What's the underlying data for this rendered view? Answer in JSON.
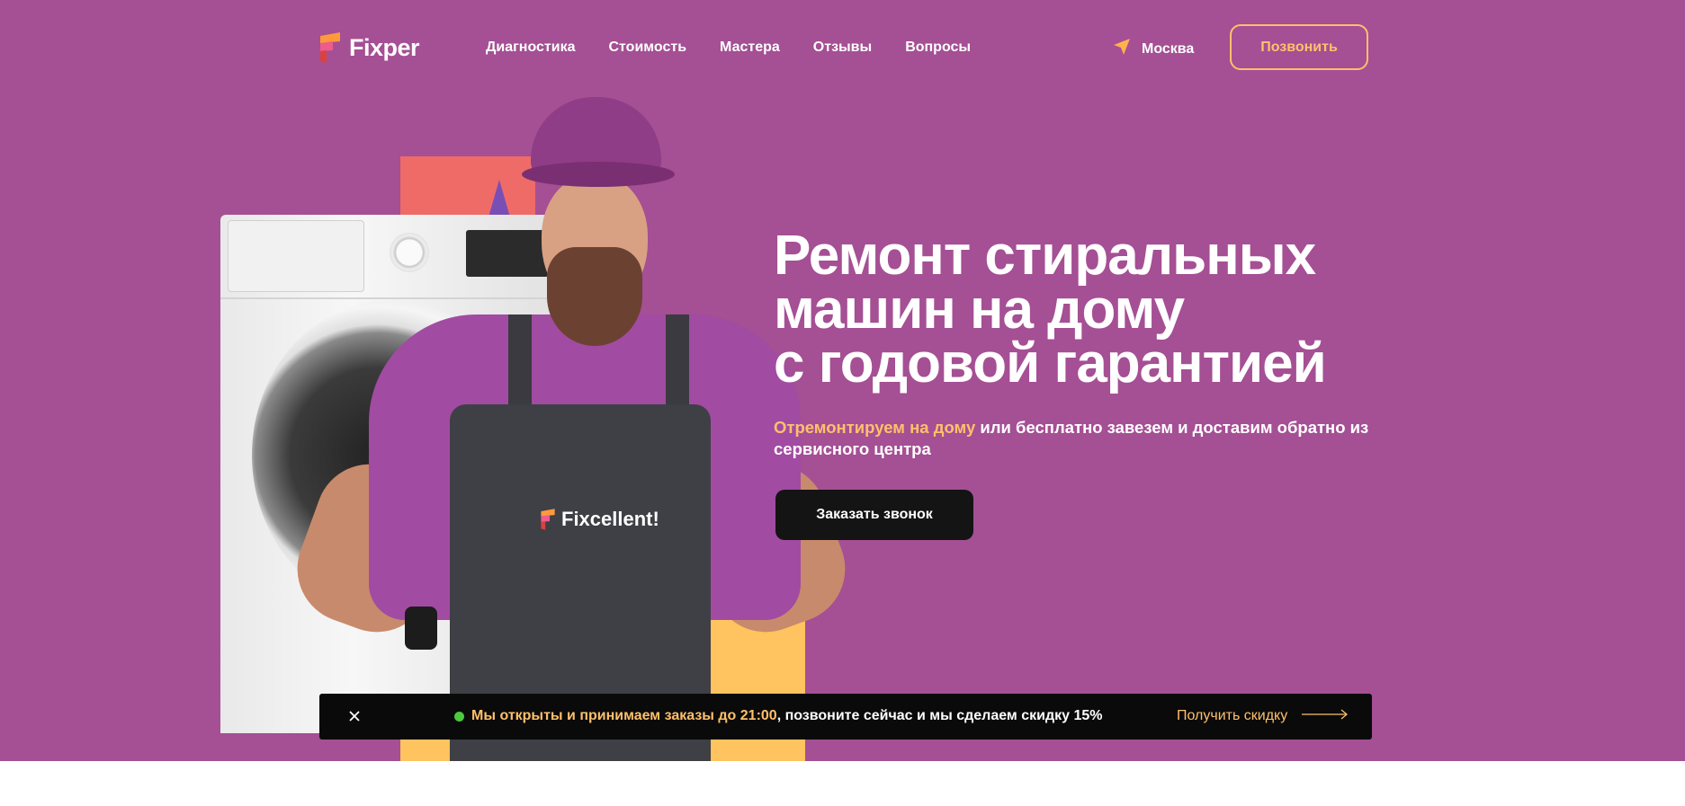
{
  "header": {
    "brand": "Fixper",
    "nav": [
      "Диагностика",
      "Стоимость",
      "Мастера",
      "Отзывы",
      "Вопросы"
    ],
    "city": "Москва",
    "call_button": "Позвонить"
  },
  "hero": {
    "title_lines": [
      "Ремонт стиральных",
      "машин на дому",
      "с годовой гарантией"
    ],
    "subtitle_accent": "Отремонтируем на дому",
    "subtitle_rest": " или бесплатно завезем и доставим обратно из сервисного центра",
    "cta": "Заказать звонок",
    "apron_brand": "Fixcellent!"
  },
  "promo_bar": {
    "message_accent": "Мы открыты и принимаем заказы до 21:00",
    "message_rest": ", позвоните сейчас и мы сделаем скидку 15%",
    "cta": "Получить скидку"
  },
  "colors": {
    "background": "#a54f94",
    "accent": "#ffc06b",
    "dark": "#141414",
    "status_open": "#4cc93d"
  },
  "icons": [
    "logo-mark-icon",
    "location-arrow-icon",
    "close-icon",
    "arrow-right-icon"
  ]
}
